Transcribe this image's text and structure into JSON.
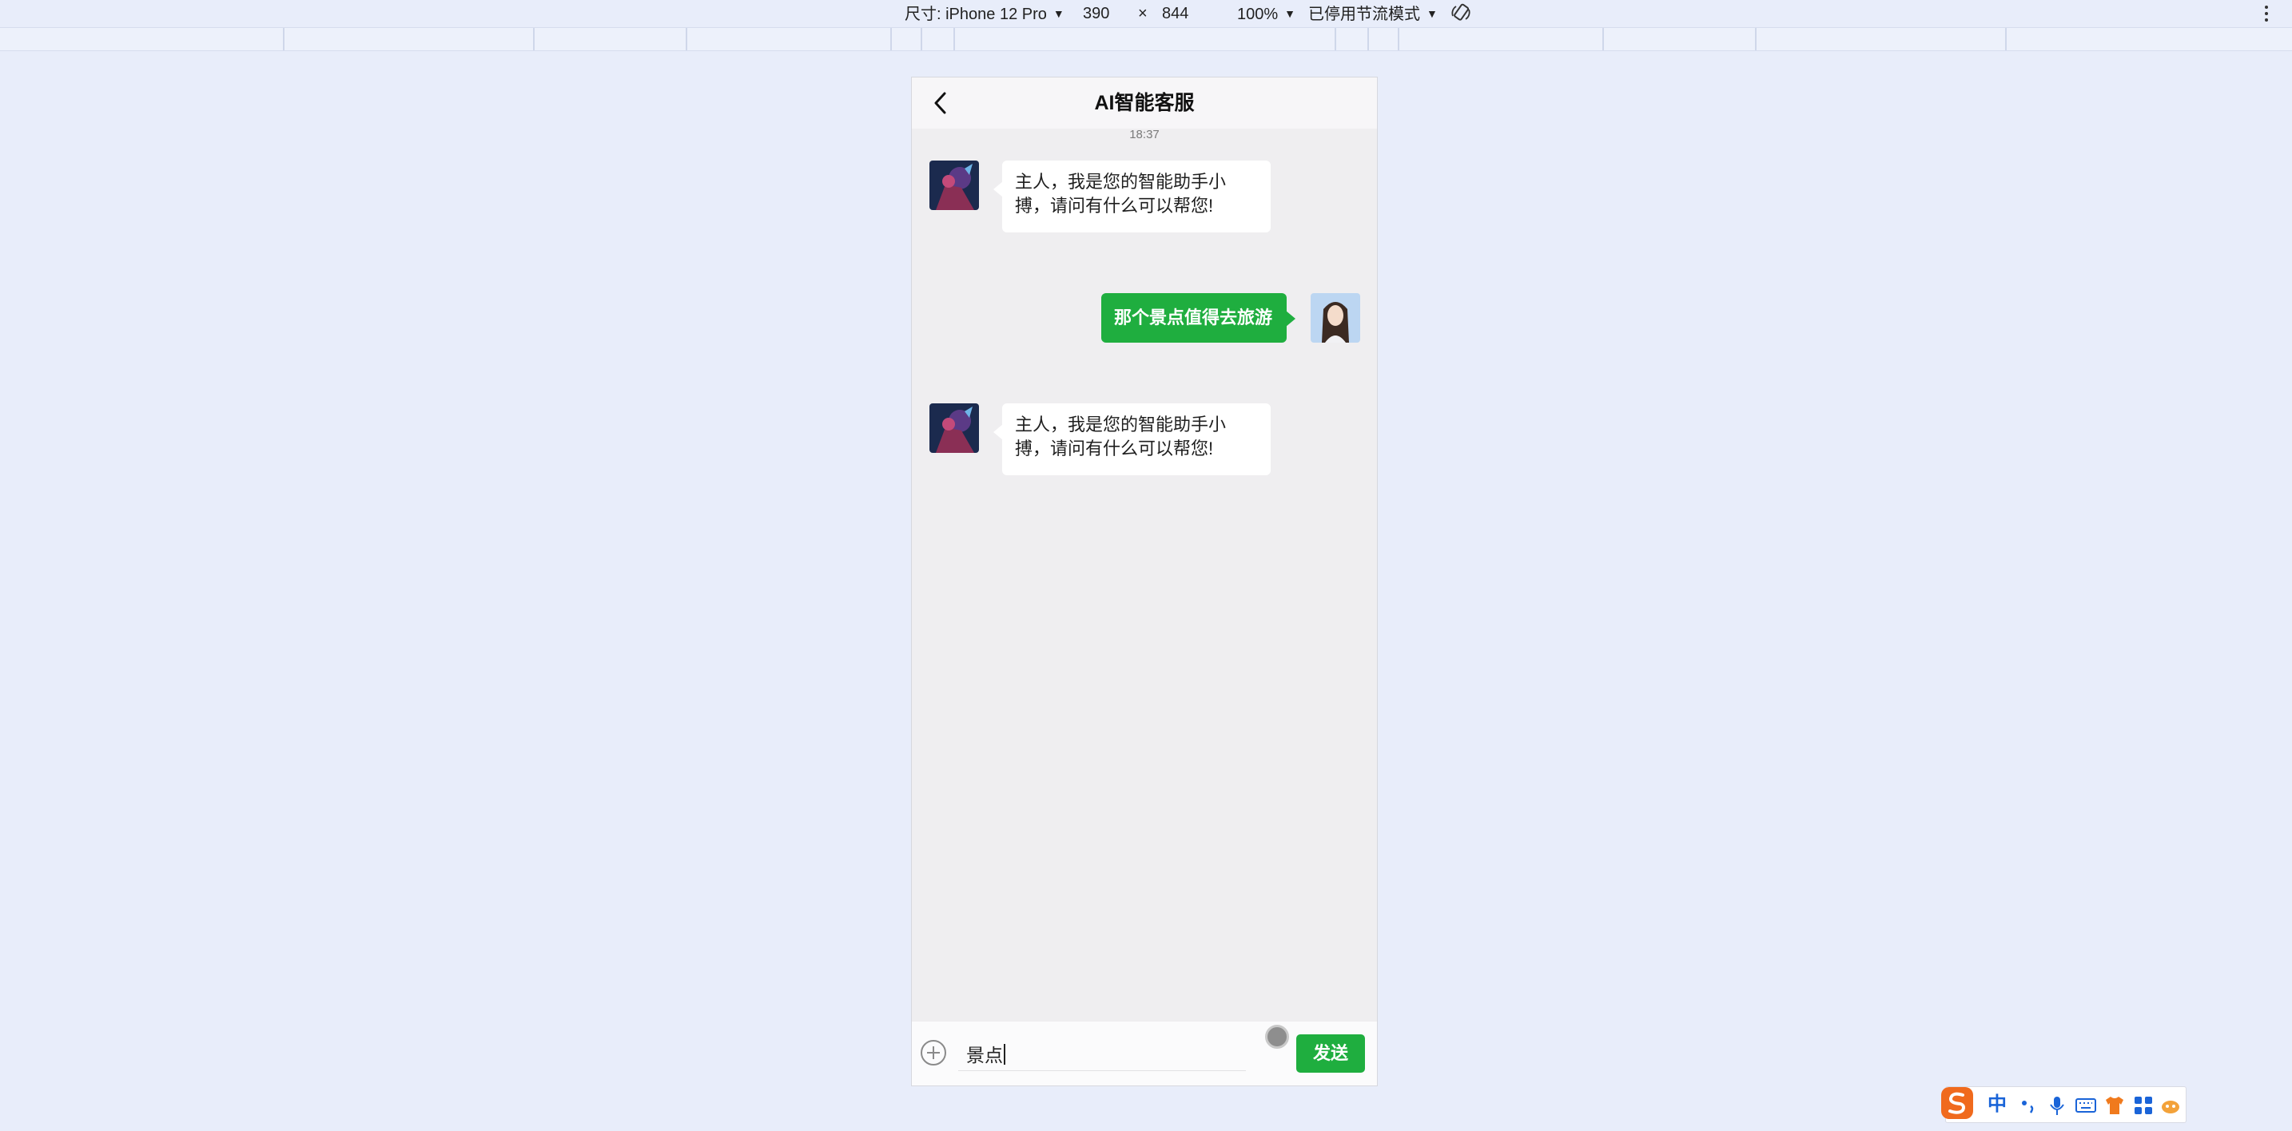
{
  "devtools": {
    "device_label": "尺寸: iPhone 12 Pro",
    "width": "390",
    "times": "×",
    "height": "844",
    "zoom": "100%",
    "throttle": "已停用节流模式"
  },
  "chat": {
    "title": "AI智能客服",
    "timestamp": "18:37",
    "messages": [
      {
        "side": "left",
        "text": "主人，我是您的智能助手小搏，请问有什么可以帮您!"
      },
      {
        "side": "right",
        "text": "那个景点值得去旅游"
      },
      {
        "side": "left",
        "text": "主人，我是您的智能助手小搏，请问有什么可以帮您!"
      }
    ],
    "input_value": "景点",
    "send_label": "发送"
  },
  "ime": {
    "lang_label": "中"
  },
  "colors": {
    "accent_green": "#1fae3f",
    "page_bg": "#e8edfa",
    "chat_bg": "#efeef0"
  }
}
